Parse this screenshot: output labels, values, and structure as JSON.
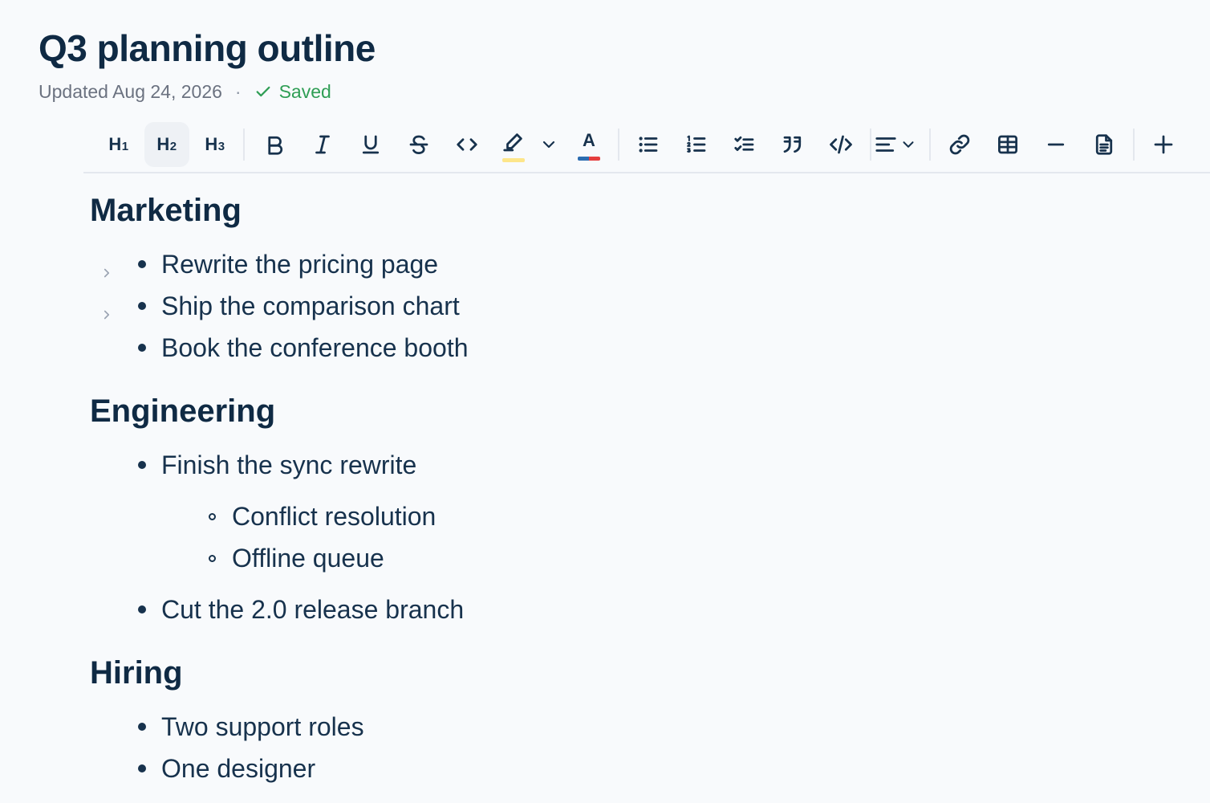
{
  "page": {
    "title": "Q3 planning outline",
    "updated": "Updated Aug 24, 2026",
    "separator": "·",
    "saved": "Saved"
  },
  "toolbar": {
    "buttons": [
      {
        "name": "h1",
        "label": "H1"
      },
      {
        "name": "h2",
        "label": "H2",
        "active": true
      },
      {
        "name": "h3",
        "label": "H3"
      },
      {
        "name": "bold",
        "icon": "bold-icon"
      },
      {
        "name": "italic",
        "icon": "italic-icon"
      },
      {
        "name": "underline",
        "icon": "underline-icon"
      },
      {
        "name": "strikethrough",
        "icon": "strikethrough-icon"
      },
      {
        "name": "inline-code",
        "icon": "code-icon"
      },
      {
        "name": "highlight",
        "icon": "highlighter-icon",
        "color": "#fde68a"
      },
      {
        "name": "text-color",
        "icon": "text-color-icon",
        "colors": [
          "#2b6cb0",
          "#e53e3e"
        ]
      },
      {
        "name": "bullet-list",
        "icon": "bullet-list-icon"
      },
      {
        "name": "numbered-list",
        "icon": "numbered-list-icon"
      },
      {
        "name": "task-list",
        "icon": "task-list-icon"
      },
      {
        "name": "blockquote",
        "icon": "quote-icon"
      },
      {
        "name": "code-block",
        "icon": "code-block-icon"
      },
      {
        "name": "align",
        "icon": "align-left-icon"
      },
      {
        "name": "link",
        "icon": "link-icon"
      },
      {
        "name": "table",
        "icon": "table-icon"
      },
      {
        "name": "horizontal-rule",
        "icon": "minus-icon"
      },
      {
        "name": "document",
        "icon": "document-icon"
      },
      {
        "name": "insert",
        "icon": "plus-icon"
      }
    ]
  },
  "sections": [
    {
      "title": "Marketing",
      "items": [
        {
          "text": "Rewrite the pricing page",
          "collapsible": true
        },
        {
          "text": "Ship the comparison chart",
          "collapsible": true
        },
        {
          "text": "Book the conference booth",
          "collapsible": false
        }
      ]
    },
    {
      "title": "Engineering",
      "items": [
        {
          "text": "Finish the sync rewrite",
          "children": [
            "Conflict resolution",
            "Offline queue"
          ]
        },
        {
          "text": "Cut the 2.0 release branch"
        }
      ]
    },
    {
      "title": "Hiring",
      "items": [
        {
          "text": "Two support roles"
        },
        {
          "text": "One designer"
        }
      ]
    }
  ]
}
